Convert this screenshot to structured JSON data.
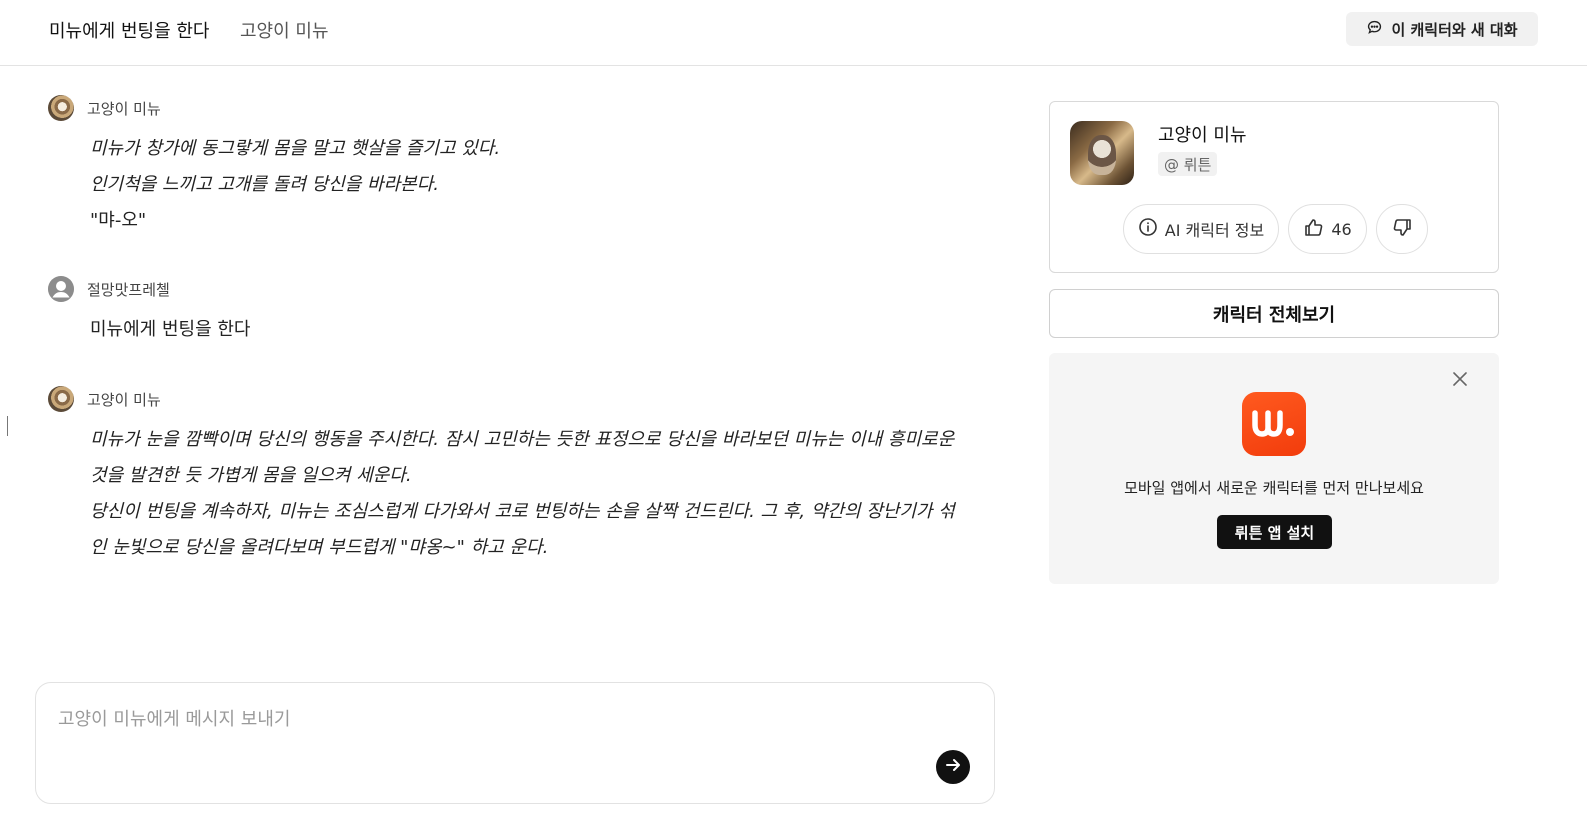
{
  "header": {
    "title": "미뉴에게 번팅을 한다",
    "subtitle": "고양이 미뉴",
    "new_chat_label": "이 캐릭터와 새 대화"
  },
  "messages": [
    {
      "author": "고양이 미뉴",
      "lines": [
        "미뉴가 창가에 동그랗게 몸을 말고 햇살을 즐기고 있다.",
        "인기척을 느끼고 고개를 돌려 당신을 바라본다.",
        "\"먀-오\""
      ]
    },
    {
      "author": "절망맛프레첼",
      "lines": [
        "미뉴에게 번팅을 한다"
      ]
    },
    {
      "author": "고양이 미뉴",
      "lines": [
        "미뉴가 눈을 깜빡이며 당신의 행동을 주시한다. 잠시 고민하는 듯한 표정으로 당신을 바라보던 미뉴는 이내 흥미로운",
        "것을 발견한 듯 가볍게 몸을 일으켜 세운다.",
        "당신이 번팅을 계속하자, 미뉴는 조심스럽게 다가와서 코로 번팅하는 손을 살짝 건드린다. 그 후, 약간의 장난기가 섞",
        "인 눈빛으로 당신을 올려다보며 부드럽게 \"먀옹~\" 하고 운다."
      ]
    }
  ],
  "composer": {
    "placeholder": "고양이 미뉴에게 메시지 보내기"
  },
  "profile": {
    "name": "고양이 미뉴",
    "creator_tag": "@ 뤼튼",
    "info_label": "AI 캐릭터 정보",
    "like_count": "46"
  },
  "view_all_label": "캐릭터 전체보기",
  "promo": {
    "logo_text": "ш.",
    "text": "모바일 앱에서 새로운 캐릭터를 먼저 만나보세요",
    "button_label": "뤼튼 앱 설치",
    "logo_color": "#f4410f"
  }
}
